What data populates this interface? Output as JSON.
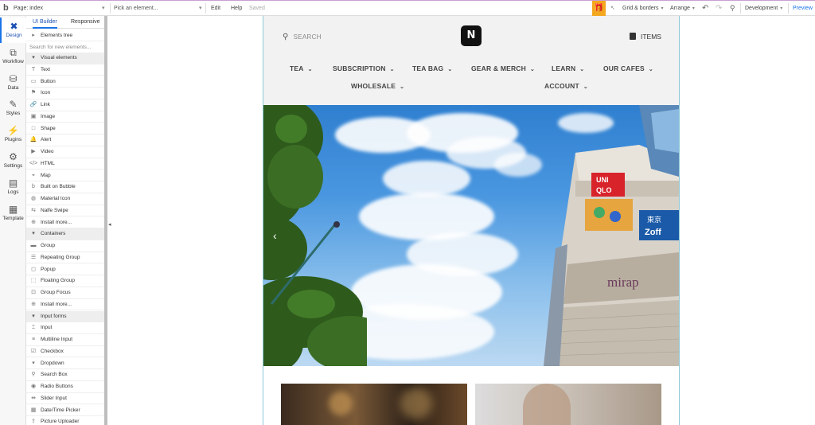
{
  "topbar": {
    "page_label": "Page: index",
    "pick_element": "Pick an element...",
    "edit": "Edit",
    "help": "Help",
    "saved": "Saved",
    "grid_borders": "Grid & borders",
    "arrange": "Arrange",
    "environment": "Development",
    "preview": "Preview"
  },
  "left_tabs": [
    {
      "label": "Design",
      "icon": "design-icon"
    },
    {
      "label": "Workflow",
      "icon": "workflow-icon"
    },
    {
      "label": "Data",
      "icon": "database-icon"
    },
    {
      "label": "Styles",
      "icon": "brush-icon"
    },
    {
      "label": "Plugins",
      "icon": "plugin-icon"
    },
    {
      "label": "Settings",
      "icon": "gear-icon"
    },
    {
      "label": "Logs",
      "icon": "document-icon"
    },
    {
      "label": "Template",
      "icon": "template-icon"
    }
  ],
  "palette": {
    "tabs": [
      "UI Builder",
      "Responsive"
    ],
    "elements_tree": "Elements tree",
    "search_placeholder": "Search for new elements...",
    "sections": {
      "visual": "Visual elements",
      "containers": "Containers",
      "inputs": "Input forms"
    },
    "visual_items": [
      "Text",
      "Button",
      "Icon",
      "Link",
      "Image",
      "Shape",
      "Alert",
      "Video",
      "HTML",
      "Map",
      "Built on Bubble",
      "Material Icon",
      "Nalfe Swipe",
      "Install more..."
    ],
    "container_items": [
      "Group",
      "Repeating Group",
      "Popup",
      "Floating Group",
      "Group Focus",
      "Install more..."
    ],
    "input_items": [
      "Input",
      "Multiline Input",
      "Checkbox",
      "Dropdown",
      "Search Box",
      "Radio Buttons",
      "Slider Input",
      "Date/Time Picker",
      "Picture Uploader"
    ]
  },
  "site": {
    "search": "SEARCH",
    "logo": "N",
    "items": "ITEMS",
    "nav_row1": [
      "TEA",
      "SUBSCRIPTION",
      "TEA BAG",
      "GEAR & MERCH",
      "LEARN",
      "OUR CAFES"
    ],
    "nav_row2": [
      "WHOLESALE",
      "ACCOUNT"
    ],
    "chevron": "⌄",
    "prev_arrow": "‹",
    "signs": {
      "uniqlo1": "UNI",
      "uniqlo2": "QLO",
      "zoff1": "東京",
      "zoff2": "Zoff",
      "mira": "mirap"
    }
  },
  "colors": {
    "accent": "#1a73e8",
    "gift": "#f3a820",
    "page_border": "#8ec9d8"
  }
}
